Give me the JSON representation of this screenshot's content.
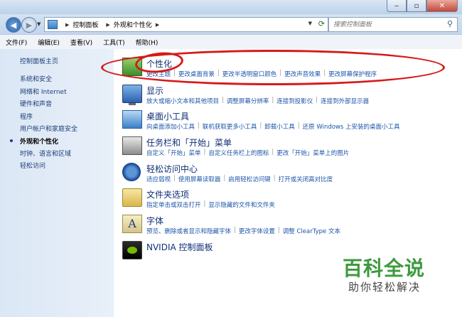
{
  "address": {
    "crumbs": [
      "控制面板",
      "外观和个性化"
    ],
    "search_placeholder": "搜索控制面板"
  },
  "menu": [
    "文件(F)",
    "编辑(E)",
    "查看(V)",
    "工具(T)",
    "帮助(H)"
  ],
  "sidebar": {
    "items": [
      "控制面板主页",
      "系统和安全",
      "网络和 Internet",
      "硬件和声音",
      "程序",
      "用户帐户和家庭安全",
      "外观和个性化",
      "时钟、语言和区域",
      "轻松访问"
    ],
    "current_index": 6
  },
  "categories": [
    {
      "title": "个性化",
      "icon": "personalization-icon",
      "links": [
        "更改主题",
        "更改桌面背景",
        "更改半透明窗口颜色",
        "更改声音效果",
        "更改屏幕保护程序"
      ]
    },
    {
      "title": "显示",
      "icon": "display-icon",
      "links": [
        "放大或缩小文本和其他项目",
        "调整屏幕分辨率",
        "连接到投影仪",
        "连接到外部显示器"
      ]
    },
    {
      "title": "桌面小工具",
      "icon": "gadgets-icon",
      "links": [
        "向桌面添加小工具",
        "联机获取更多小工具",
        "卸载小工具",
        "还原 Windows 上安装的桌面小工具"
      ]
    },
    {
      "title": "任务栏和「开始」菜单",
      "icon": "taskbar-icon",
      "links": [
        "自定义「开始」菜单",
        "自定义任务栏上的图标",
        "更改「开始」菜单上的图片"
      ]
    },
    {
      "title": "轻松访问中心",
      "icon": "ease-of-access-icon",
      "links": [
        "适应弱视",
        "使用屏幕读取器",
        "启用轻松访问键",
        "打开或关闭高对比度"
      ]
    },
    {
      "title": "文件夹选项",
      "icon": "folder-options-icon",
      "links": [
        "指定单击或双击打开",
        "显示隐藏的文件和文件夹"
      ]
    },
    {
      "title": "字体",
      "icon": "fonts-icon",
      "links": [
        "预览、删除或者显示和隐藏字体",
        "更改字体设置",
        "调整 ClearType 文本"
      ]
    },
    {
      "title": "NVIDIA 控制面板",
      "icon": "nvidia-icon",
      "links": []
    }
  ],
  "watermark": {
    "title": "百科全说",
    "subtitle": "助你轻松解决"
  },
  "colors": {
    "annotation": "#d61a1a",
    "link": "#1b54a8",
    "title": "#0e2e75"
  }
}
